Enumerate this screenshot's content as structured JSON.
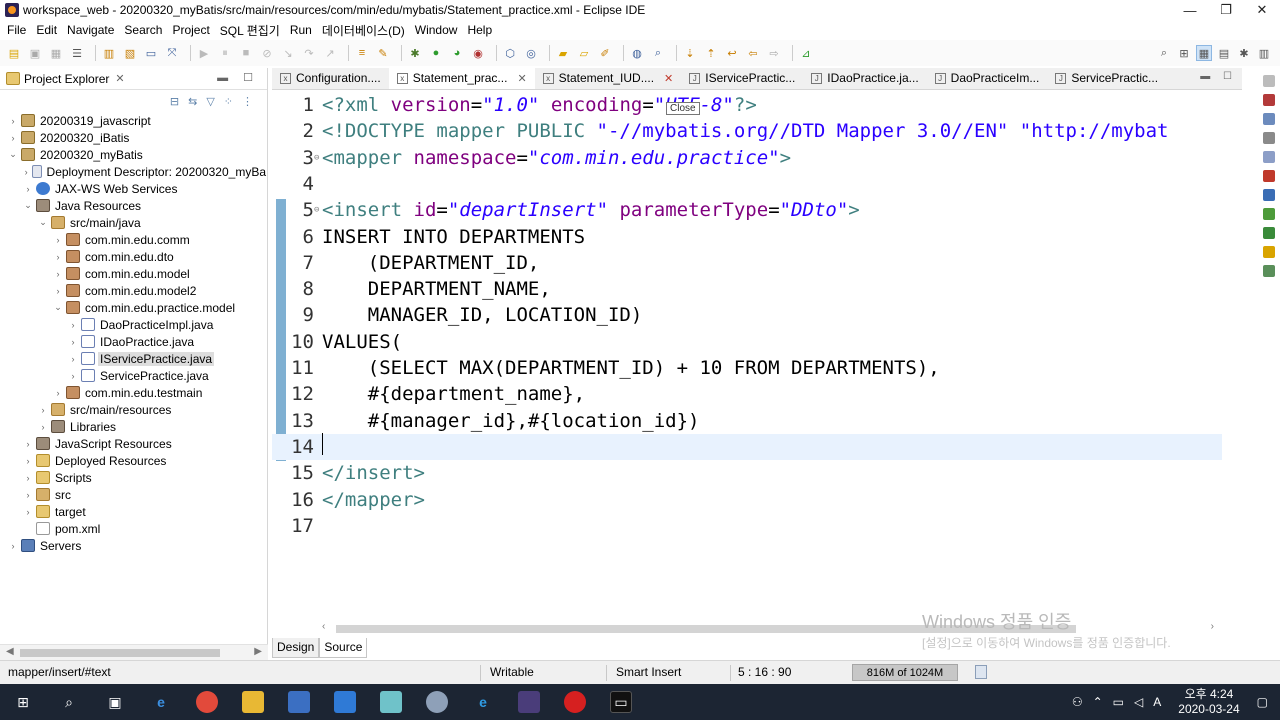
{
  "window": {
    "title": "workspace_web - 20200320_myBatis/src/main/resources/com/min/edu/mybatis/Statement_practice.xml - Eclipse IDE",
    "minimize": "—",
    "maximize": "❐",
    "close": "✕"
  },
  "menu": [
    "File",
    "Edit",
    "Navigate",
    "Search",
    "Project",
    "SQL 편집기",
    "Run",
    "데이터베이스(D)",
    "Window",
    "Help"
  ],
  "explorer": {
    "title": "Project Explorer",
    "tree": [
      {
        "indent": 0,
        "twisty": "›",
        "icon": "project",
        "label": "20200319_javascript"
      },
      {
        "indent": 0,
        "twisty": "›",
        "icon": "project",
        "label": "20200320_iBatis"
      },
      {
        "indent": 0,
        "twisty": "⌄",
        "icon": "project",
        "label": "20200320_myBatis"
      },
      {
        "indent": 1,
        "twisty": "›",
        "icon": "desc",
        "label": "Deployment Descriptor: 20200320_myBa"
      },
      {
        "indent": 1,
        "twisty": "›",
        "icon": "jaxws",
        "label": "JAX-WS Web Services"
      },
      {
        "indent": 1,
        "twisty": "⌄",
        "icon": "lib",
        "label": "Java Resources"
      },
      {
        "indent": 2,
        "twisty": "⌄",
        "icon": "srcfolder",
        "label": "src/main/java"
      },
      {
        "indent": 3,
        "twisty": "›",
        "icon": "package",
        "label": "com.min.edu.comm"
      },
      {
        "indent": 3,
        "twisty": "›",
        "icon": "package",
        "label": "com.min.edu.dto"
      },
      {
        "indent": 3,
        "twisty": "›",
        "icon": "package",
        "label": "com.min.edu.model"
      },
      {
        "indent": 3,
        "twisty": "›",
        "icon": "package",
        "label": "com.min.edu.model2"
      },
      {
        "indent": 3,
        "twisty": "⌄",
        "icon": "package",
        "label": "com.min.edu.practice.model"
      },
      {
        "indent": 4,
        "twisty": "›",
        "icon": "java",
        "label": "DaoPracticeImpl.java"
      },
      {
        "indent": 4,
        "twisty": "›",
        "icon": "java",
        "label": "IDaoPractice.java"
      },
      {
        "indent": 4,
        "twisty": "›",
        "icon": "java",
        "label": "IServicePractice.java",
        "selected": true
      },
      {
        "indent": 4,
        "twisty": "›",
        "icon": "java",
        "label": "ServicePractice.java"
      },
      {
        "indent": 3,
        "twisty": "›",
        "icon": "package",
        "label": "com.min.edu.testmain"
      },
      {
        "indent": 2,
        "twisty": "›",
        "icon": "srcfolder",
        "label": "src/main/resources"
      },
      {
        "indent": 2,
        "twisty": "›",
        "icon": "lib",
        "label": "Libraries"
      },
      {
        "indent": 1,
        "twisty": "›",
        "icon": "lib",
        "label": "JavaScript Resources"
      },
      {
        "indent": 1,
        "twisty": "›",
        "icon": "folder",
        "label": "Deployed Resources"
      },
      {
        "indent": 1,
        "twisty": "›",
        "icon": "folder",
        "label": "Scripts"
      },
      {
        "indent": 1,
        "twisty": "›",
        "icon": "srcfolder",
        "label": "src"
      },
      {
        "indent": 1,
        "twisty": "›",
        "icon": "folder",
        "label": "target"
      },
      {
        "indent": 1,
        "twisty": "",
        "icon": "xml",
        "label": "pom.xml"
      },
      {
        "indent": 0,
        "twisty": "›",
        "icon": "servers",
        "label": "Servers"
      }
    ]
  },
  "editor": {
    "tabs": [
      {
        "label": "Configuration....",
        "icon": "x",
        "close": false
      },
      {
        "label": "Statement_prac...",
        "icon": "x",
        "close": true,
        "active": true
      },
      {
        "label": "Statement_IUD....",
        "icon": "x",
        "close": true,
        "hot": true
      },
      {
        "label": "IServicePractic...",
        "icon": "J",
        "close": false
      },
      {
        "label": "IDaoPractice.ja...",
        "icon": "J",
        "close": false
      },
      {
        "label": "DaoPracticeIm...",
        "icon": "J",
        "close": false
      },
      {
        "label": "ServicePractic...",
        "icon": "J",
        "close": false
      }
    ],
    "tooltip": "Close",
    "lines": [
      {
        "n": "1",
        "fold": "",
        "segments": [
          [
            "tag",
            "<?xml "
          ],
          [
            "attr",
            "version"
          ],
          [
            "plain",
            "="
          ],
          [
            "str",
            "\"1.0\""
          ],
          [
            "plain",
            " "
          ],
          [
            "attr",
            "encoding"
          ],
          [
            "plain",
            "="
          ],
          [
            "str",
            "\"UTF-8\""
          ],
          [
            "tag",
            "?>"
          ]
        ]
      },
      {
        "n": "2",
        "fold": "",
        "segments": [
          [
            "tag",
            "<!DOCTYPE mapper PUBLIC "
          ],
          [
            "str2",
            "\"-//mybatis.org//DTD Mapper 3.0//EN\" \"http://mybat"
          ]
        ]
      },
      {
        "n": "3",
        "fold": "⊖",
        "segments": [
          [
            "tag",
            "<mapper "
          ],
          [
            "attr",
            "namespace"
          ],
          [
            "plain",
            "="
          ],
          [
            "str",
            "\"com.min.edu.practice\""
          ],
          [
            "tag",
            ">"
          ]
        ]
      },
      {
        "n": "4",
        "fold": "",
        "segments": []
      },
      {
        "n": "5",
        "fold": "⊖",
        "segments": [
          [
            "tag",
            "<insert "
          ],
          [
            "attr",
            "id"
          ],
          [
            "plain",
            "="
          ],
          [
            "str",
            "\"departInsert\""
          ],
          [
            "plain",
            " "
          ],
          [
            "attr",
            "parameterType"
          ],
          [
            "plain",
            "="
          ],
          [
            "str",
            "\"DDto\""
          ],
          [
            "tag",
            ">"
          ]
        ]
      },
      {
        "n": "6",
        "fold": "",
        "segments": [
          [
            "plain",
            "INSERT INTO DEPARTMENTS"
          ]
        ]
      },
      {
        "n": "7",
        "fold": "",
        "segments": [
          [
            "plain",
            "    (DEPARTMENT_ID,"
          ]
        ]
      },
      {
        "n": "8",
        "fold": "",
        "segments": [
          [
            "plain",
            "    DEPARTMENT_NAME,"
          ]
        ]
      },
      {
        "n": "9",
        "fold": "",
        "segments": [
          [
            "plain",
            "    MANAGER_ID, LOCATION_ID)"
          ]
        ]
      },
      {
        "n": "10",
        "fold": "",
        "segments": [
          [
            "plain",
            "VALUES("
          ]
        ]
      },
      {
        "n": "11",
        "fold": "",
        "segments": [
          [
            "plain",
            "    (SELECT MAX(DEPARTMENT_ID) + 10 FROM DEPARTMENTS),"
          ]
        ]
      },
      {
        "n": "12",
        "fold": "",
        "segments": [
          [
            "plain",
            "    #{department_name},"
          ]
        ]
      },
      {
        "n": "13",
        "fold": "",
        "segments": [
          [
            "plain",
            "    #{manager_id},#{location_id})"
          ]
        ]
      },
      {
        "n": "14",
        "fold": "",
        "segments": [],
        "current": true
      },
      {
        "n": "15",
        "fold": "",
        "segments": [
          [
            "tag",
            "</insert>"
          ]
        ]
      },
      {
        "n": "16",
        "fold": "",
        "segments": [
          [
            "tag",
            "</mapper>"
          ]
        ]
      },
      {
        "n": "17",
        "fold": "",
        "segments": []
      }
    ],
    "mode_tabs": [
      "Design",
      "Source"
    ],
    "active_mode": "Source"
  },
  "watermark": {
    "line1": "Windows 정품 인증",
    "line2": "[설정]으로 이동하여 Windows를 정품 인증합니다."
  },
  "status": {
    "path": "mapper/insert/#text",
    "writable": "Writable",
    "insert_mode": "Smart Insert",
    "position": "5 : 16 : 90",
    "heap": "816M of 1024M"
  },
  "taskbar": {
    "time": "오후 4:24",
    "date": "2020-03-24",
    "ime": "A"
  },
  "colors": {
    "xml_tag": "#3f7f7f",
    "xml_attr": "#7f007f",
    "xml_string": "#2a00ff",
    "current_line": "#e8f2fe",
    "taskbar": "#1c2533"
  }
}
